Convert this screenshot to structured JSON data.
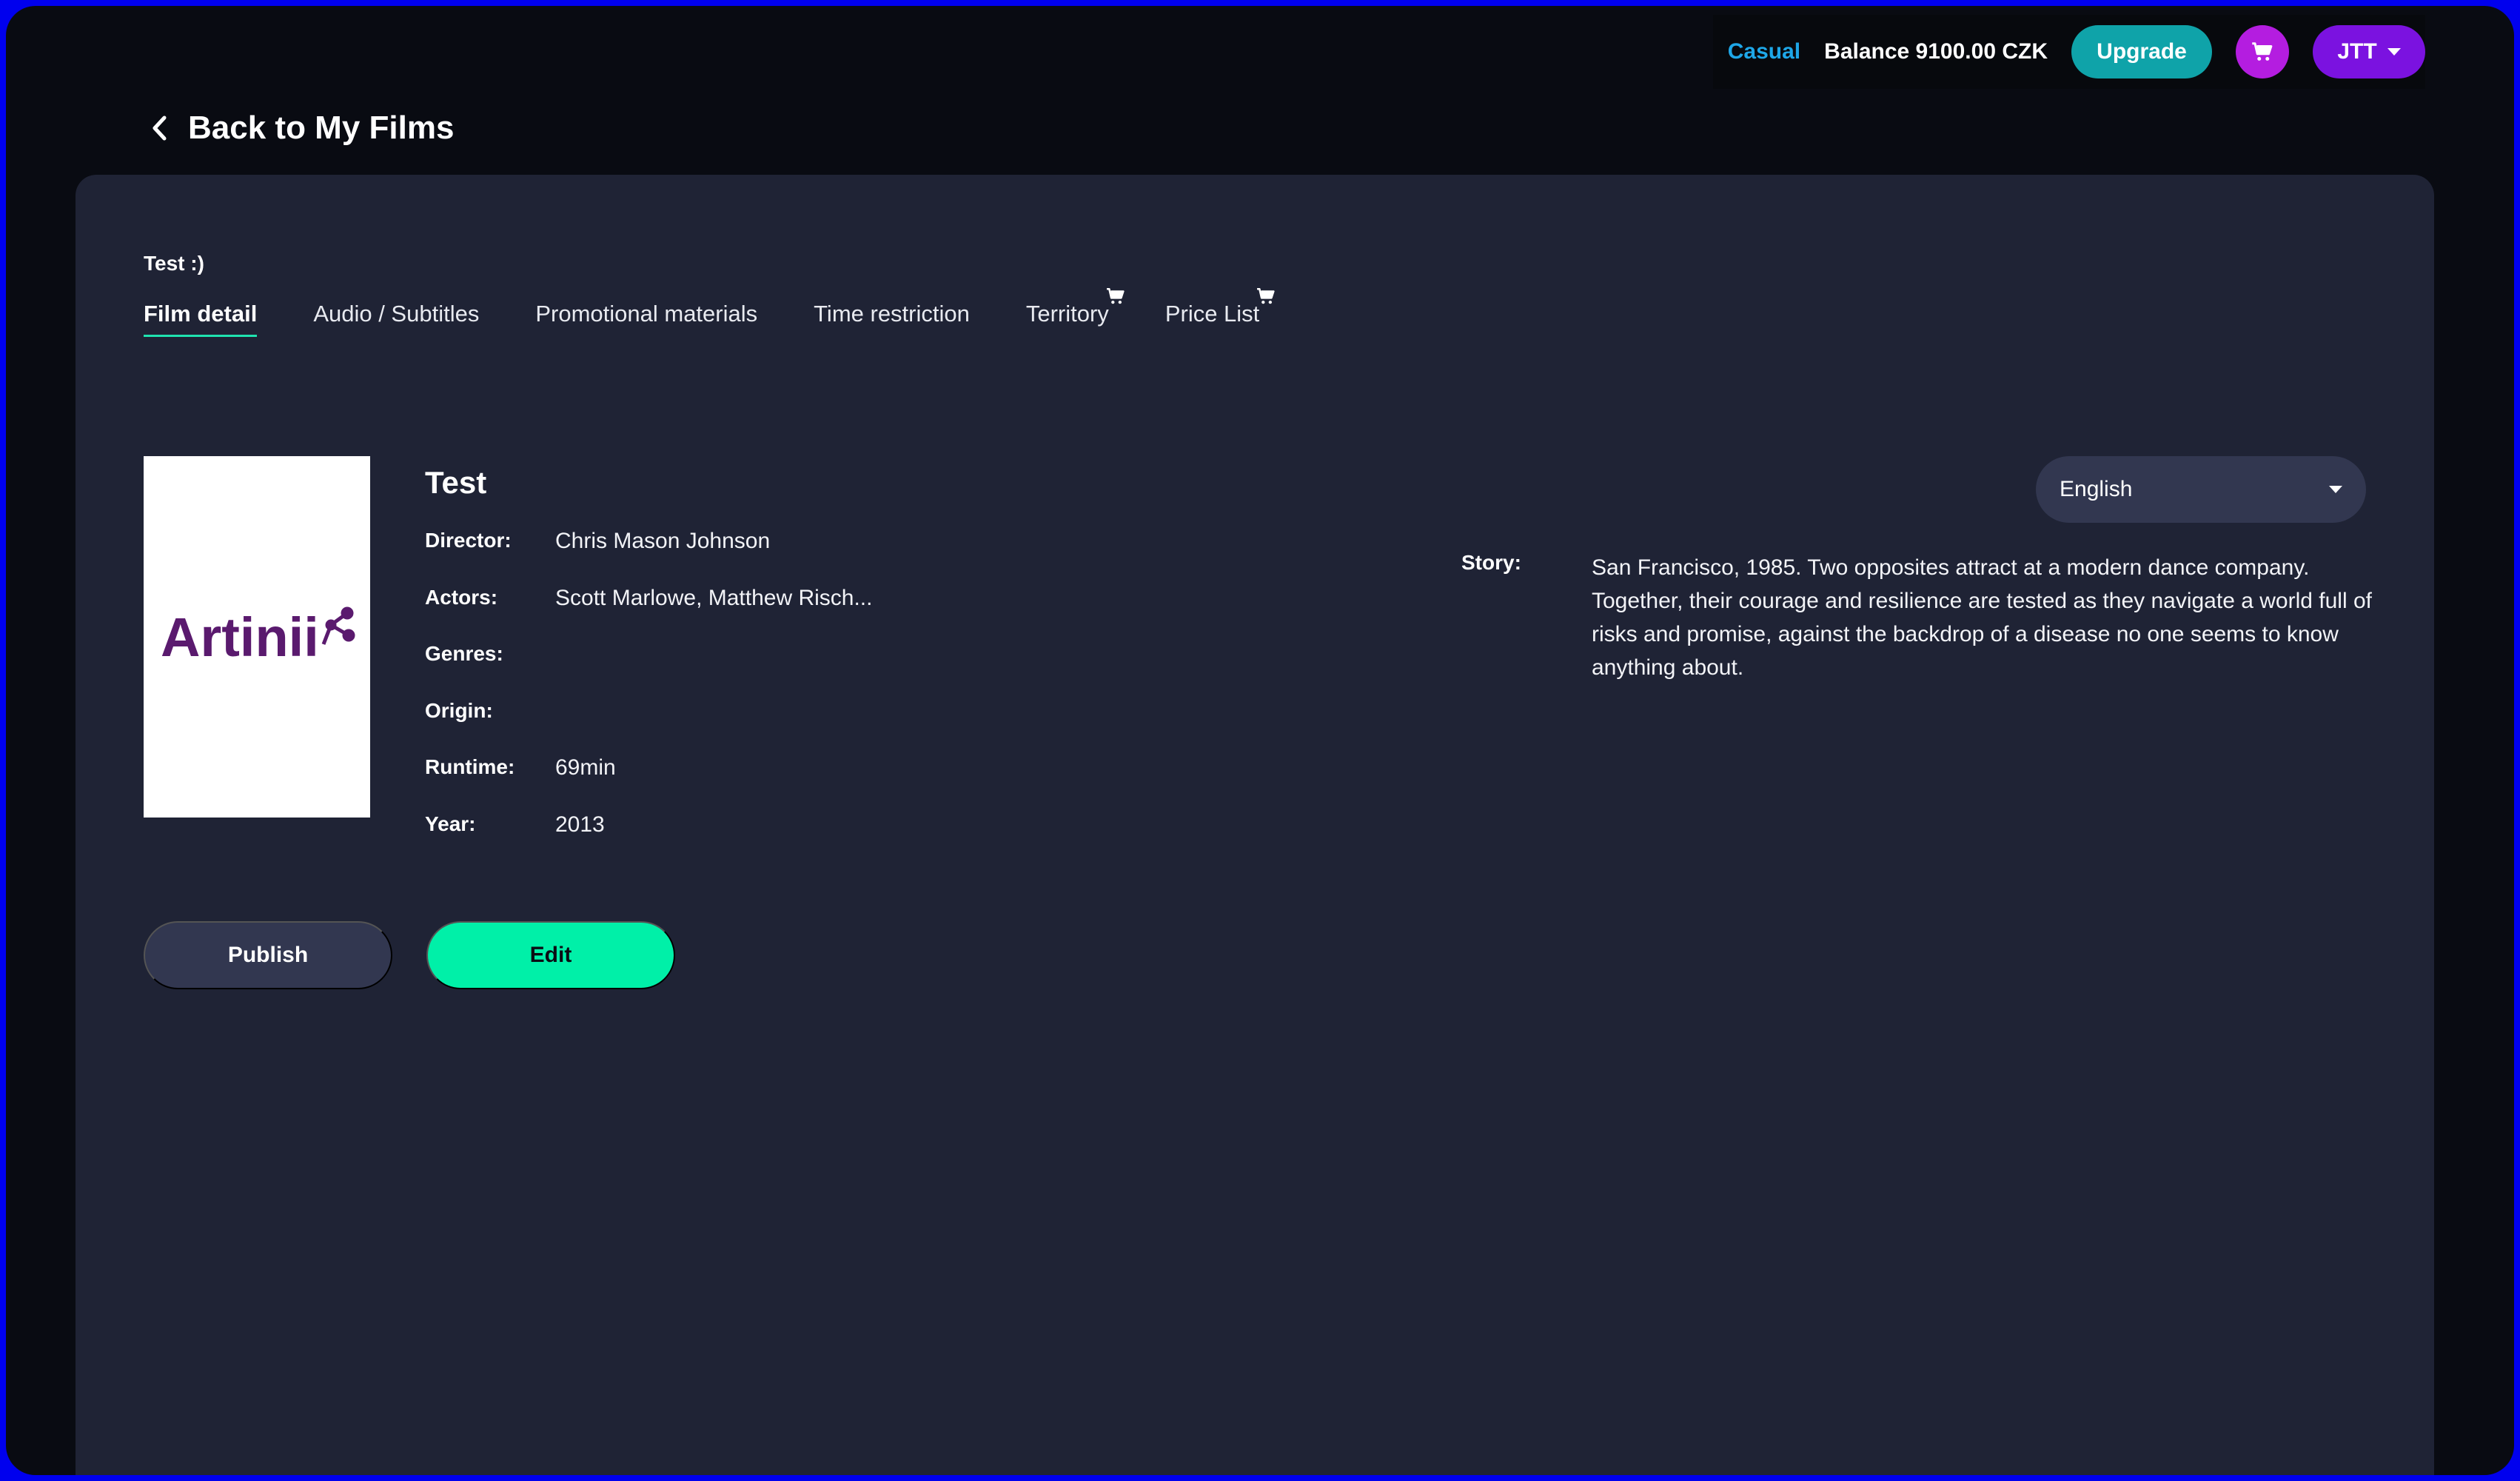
{
  "header": {
    "plan_label": "Casual",
    "balance_text": "Balance 9100.00 CZK",
    "upgrade_label": "Upgrade",
    "user_initials": "JTT"
  },
  "back_link": {
    "label": "Back to My Films"
  },
  "film_crumb": "Test :)",
  "tabs": [
    {
      "label": "Film detail",
      "active": true
    },
    {
      "label": "Audio / Subtitles"
    },
    {
      "label": "Promotional materials"
    },
    {
      "label": "Time restriction"
    },
    {
      "label": "Territory",
      "icon": "cart-icon"
    },
    {
      "label": "Price List",
      "icon": "cart-icon"
    }
  ],
  "poster": {
    "logo_text": "Artinii",
    "icon": "network-nodes-icon"
  },
  "film": {
    "title": "Test",
    "fields": [
      {
        "label": "Director:",
        "value": "Chris Mason Johnson"
      },
      {
        "label": "Actors:",
        "value": "Scott Marlowe, Matthew Risch..."
      },
      {
        "label": "Genres:",
        "value": ""
      },
      {
        "label": "Origin:",
        "value": ""
      },
      {
        "label": "Runtime:",
        "value": "69min"
      },
      {
        "label": "Year:",
        "value": "2013"
      }
    ],
    "story_label": "Story:",
    "story": "San Francisco, 1985. Two opposites attract at a modern dance company. Together, their courage and resilience are tested as they navigate a world full of risks and promise, against the backdrop of a disease no one seems to know anything about."
  },
  "language_select": {
    "value": "English"
  },
  "actions": {
    "publish_label": "Publish",
    "edit_label": "Edit"
  },
  "colors": {
    "page_bg": "#090b12",
    "panel_bg": "#1f2335",
    "accent_green": "#00f0a8",
    "upgrade_teal": "#0fa3a9",
    "cart_purple": "#b41de0",
    "user_purple": "#7b12e0",
    "plan_blue": "#1ea7e8",
    "logo_purple": "#5a1a6e"
  }
}
